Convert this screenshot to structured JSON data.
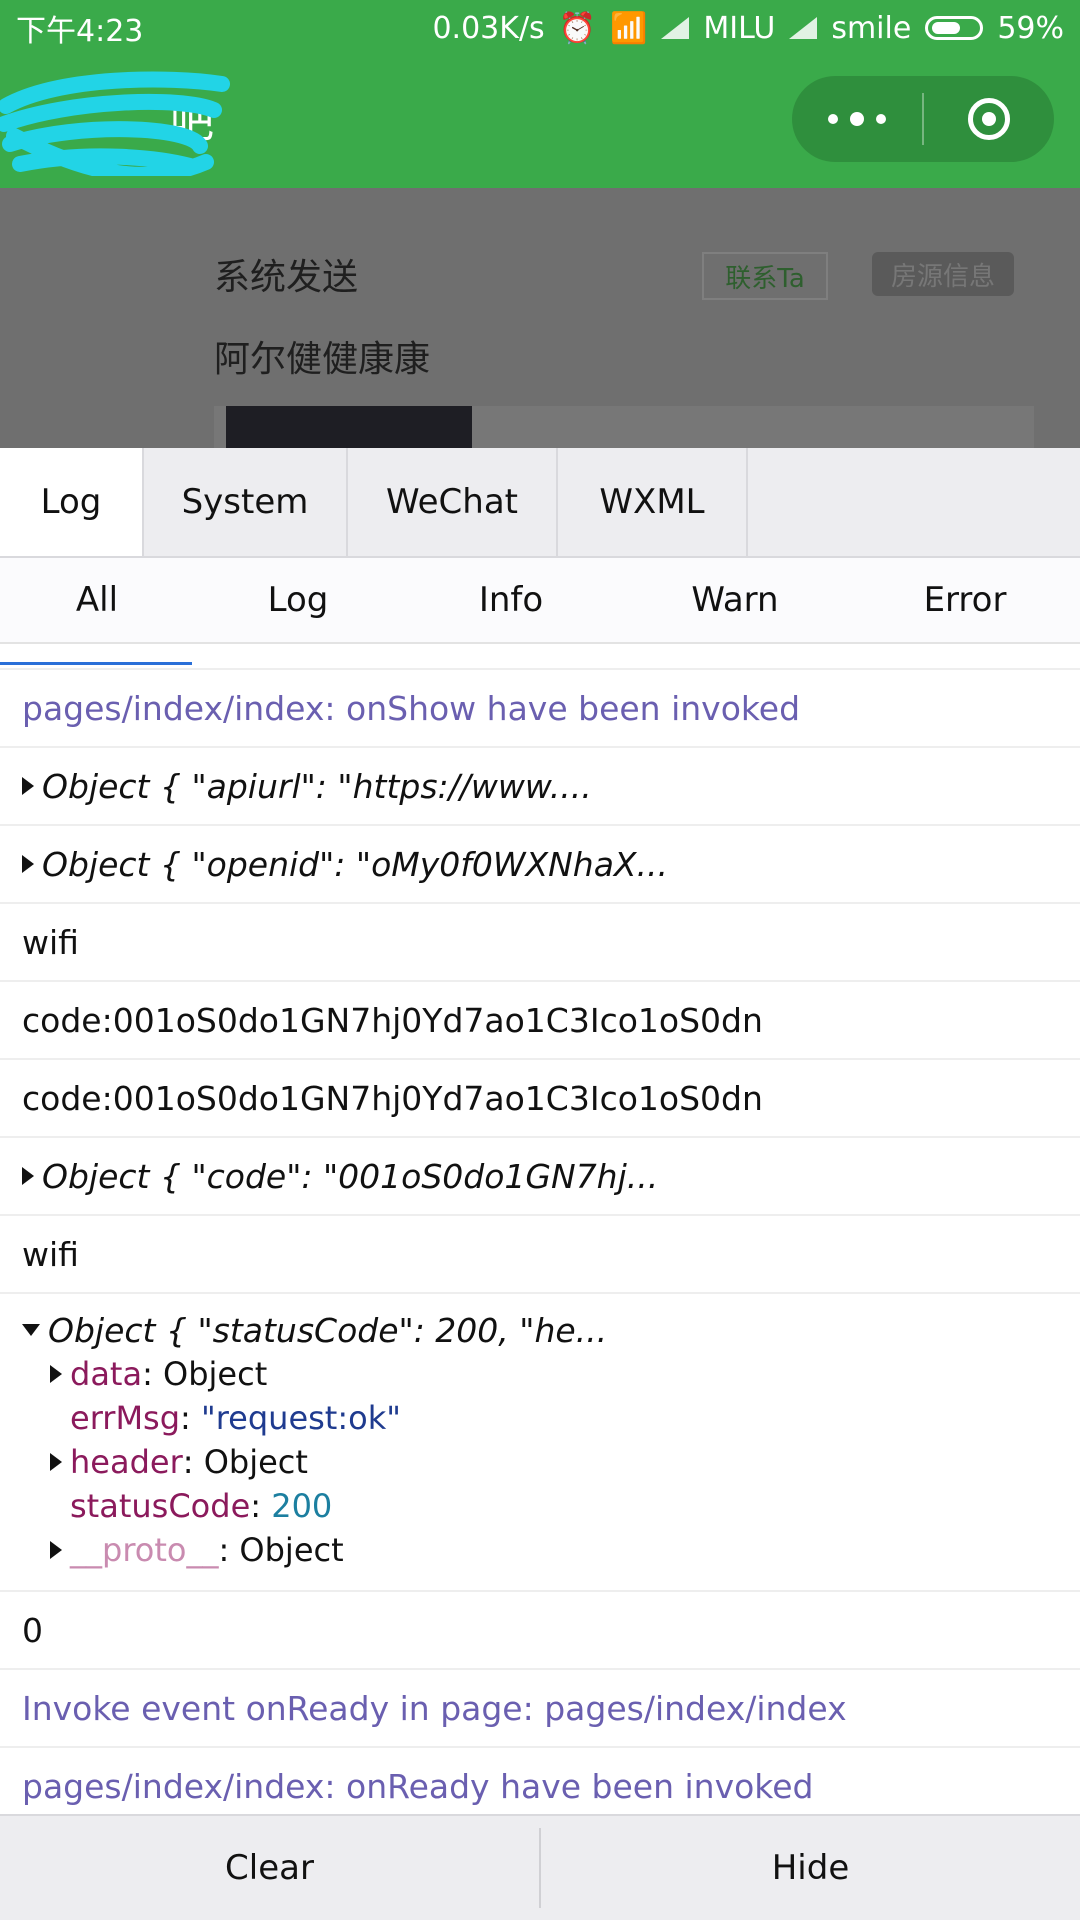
{
  "status_bar": {
    "time": "下午4:23",
    "net_speed": "0.03K/s",
    "carrier1": "MILU",
    "carrier2": "smile",
    "battery": "59%"
  },
  "header": {
    "title_visible": "吧"
  },
  "page": {
    "system_send": "系统发送",
    "contact_button": "联系Ta",
    "house_info_button": "房源信息",
    "user_name": "阿尔健健康康"
  },
  "console": {
    "tabs": [
      "Log",
      "System",
      "WeChat",
      "WXML"
    ],
    "filters": [
      "All",
      "Log",
      "Info",
      "Warn",
      "Error"
    ],
    "logs": {
      "r1": "pages/index/index: onShow have been invoked",
      "r2": "Object { \"apiurl\": \"https://www....",
      "r3": "Object { \"openid\": \"oMy0f0WXNhaX...",
      "r4": "wifi",
      "r5": "code:001oS0do1GN7hj0Yd7ao1C3Ico1oS0dn",
      "r6": "code:001oS0do1GN7hj0Yd7ao1C3Ico1oS0dn",
      "r7": "Object { \"code\": \"001oS0do1GN7hj...",
      "r8": "wifi",
      "r9_head": "Object { \"statusCode\": 200, \"he...",
      "r9_props": {
        "data_key": "data",
        "data_val": "Object",
        "errmsg_key": "errMsg",
        "errmsg_val": "\"request:ok\"",
        "header_key": "header",
        "header_val": "Object",
        "status_key": "statusCode",
        "status_val": "200",
        "proto_key": "__proto__",
        "proto_val": "Object"
      },
      "r10": "0",
      "r11": "Invoke event onReady in page: pages/index/index",
      "r12": "pages/index/index: onReady have been invoked"
    },
    "clear_button": "Clear",
    "hide_button": "Hide"
  },
  "colors": {
    "wechat_green": "#3aaa4a",
    "info_text": "#6a5fb0",
    "key_text": "#8b1a5c"
  }
}
